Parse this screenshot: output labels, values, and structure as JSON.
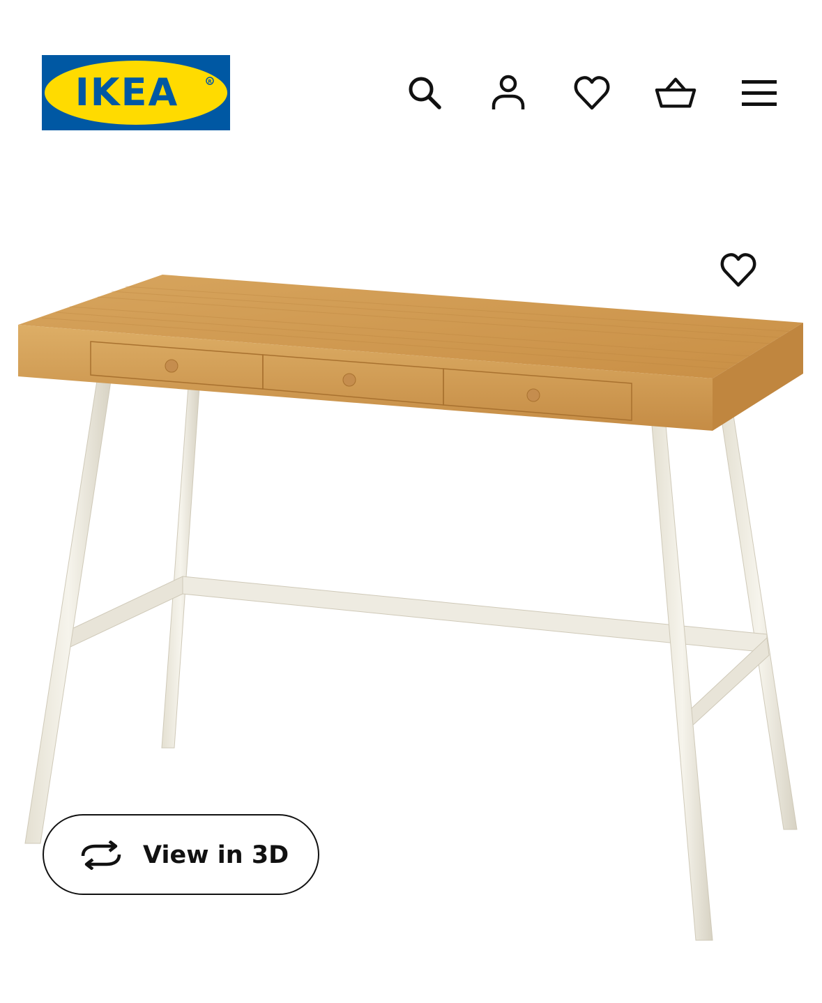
{
  "header": {
    "logo_text": "IKEA",
    "logo_colors": {
      "blue": "#0058A3",
      "yellow": "#FFDB00"
    },
    "nav_icons": [
      "search-icon",
      "account-icon",
      "favourites-icon",
      "basket-icon",
      "menu-icon"
    ]
  },
  "product": {
    "image": "desk-with-three-drawers-bamboo-top-white-legs",
    "favourite_icon": "heart-icon",
    "view_3d": {
      "label": "View in 3D",
      "icon": "rotate-3d-icon"
    }
  }
}
